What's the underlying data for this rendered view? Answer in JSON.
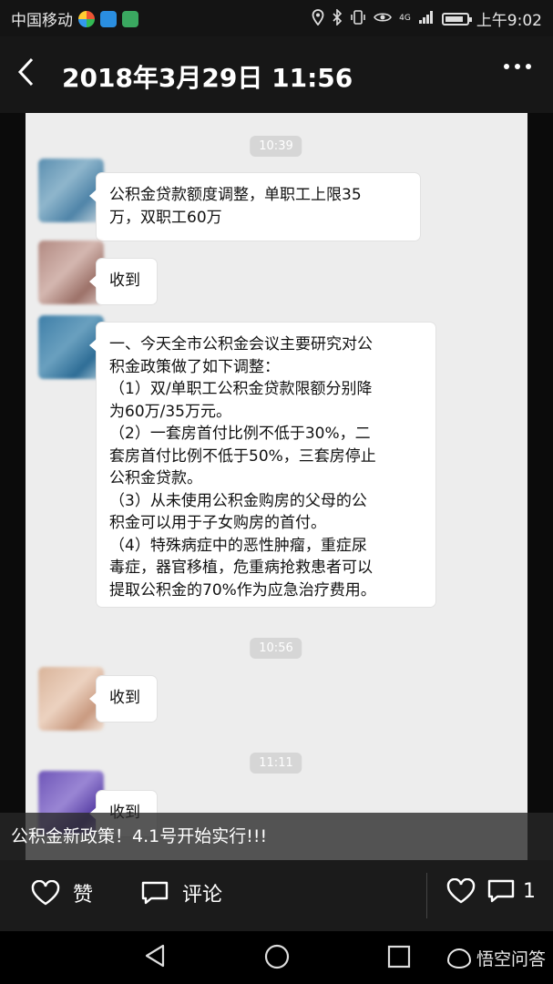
{
  "status_bar": {
    "carrier": "中国移动",
    "network": "4G",
    "time": "上午9:02"
  },
  "header": {
    "title": "2018年3月29日 11:56",
    "back_icon": "back-chevron-icon",
    "more_icon": "more-dots-icon"
  },
  "chat": {
    "timestamps": [
      "10:39",
      "10:56",
      "11:11"
    ],
    "messages": [
      {
        "lines": [
          "公积金贷款额度调整，单职工上限35",
          "万，双职工60万"
        ]
      },
      {
        "lines": [
          "收到"
        ]
      },
      {
        "lines": [
          "一、今天全市公积金会议主要研究对公",
          "积金政策做了如下调整：",
          "（1）双/单职工公积金贷款限额分别降",
          "为60万/35万元。",
          "（2）一套房首付比例不低于30%，二",
          "套房首付比例不低于50%，三套房停止",
          "公积金贷款。",
          "（3）从未使用公积金购房的父母的公",
          "积金可以用于子女购房的首付。",
          "（4）特殊病症中的恶性肿瘤，重症尿",
          "毒症，器官移植，危重病抢救患者可以",
          "提取公积金的70%作为应急治疗费用。"
        ]
      },
      {
        "lines": [
          "收到"
        ]
      },
      {
        "lines": [
          "收到"
        ]
      }
    ]
  },
  "caption": "公积金新政策！4.1号开始实行!!!",
  "actions": {
    "like_label": "赞",
    "comment_label": "评论",
    "like_count": "",
    "comment_count": "1"
  },
  "watermark": "悟空问答",
  "colors": {
    "bubble_bg": "#ffffff",
    "chat_bg": "#ededed",
    "bar_bg": "#1b1b1b"
  }
}
